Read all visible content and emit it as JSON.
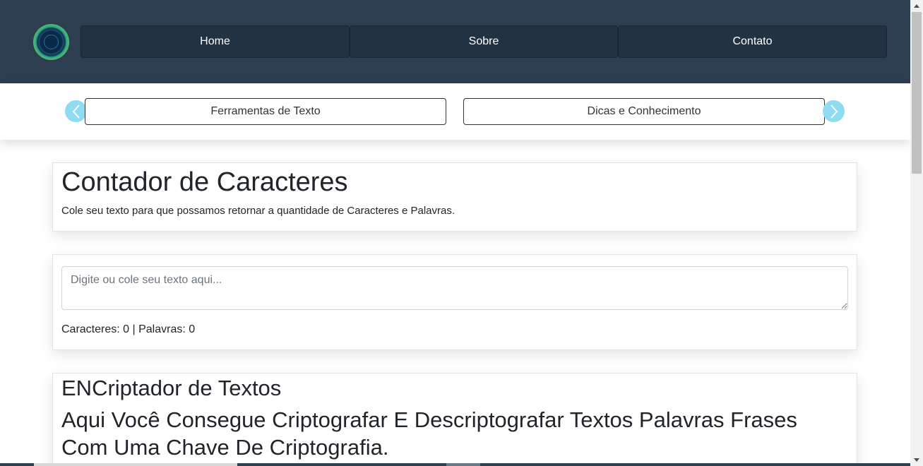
{
  "header": {
    "logo": "site-logo",
    "nav": [
      {
        "label": "Home"
      },
      {
        "label": "Sobre"
      },
      {
        "label": "Contato"
      }
    ]
  },
  "categories": {
    "prev_icon": "chevron-left-icon",
    "next_icon": "chevron-right-icon",
    "items": [
      {
        "label": "Ferramentas de Texto"
      },
      {
        "label": "Dicas e Conhecimento"
      }
    ]
  },
  "counter_section": {
    "title": "Contador de Caracteres",
    "description": "Cole seu texto para que possamos retornar a quantidade de Caracteres e Palavras.",
    "input": {
      "placeholder": "Digite ou cole seu texto aqui...",
      "value": ""
    },
    "result": "Caracteres: 0 | Palavras: 0"
  },
  "encrypt_section": {
    "title": "ENCriptador de Textos",
    "subtitle": "Aqui Você Consegue Criptografar E Descriptografar Textos Palavras Frases Com Uma Chave De Criptografia."
  },
  "colors": {
    "header_bg": "#2c3e50",
    "nav_button_bg": "#233242",
    "arrow_bg": "#8fdcf2"
  }
}
